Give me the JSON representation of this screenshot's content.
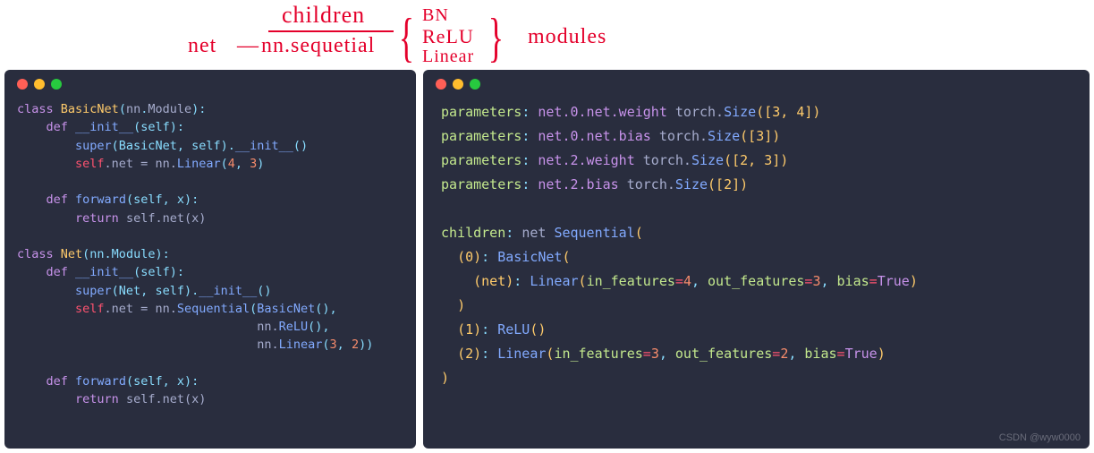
{
  "annotation": {
    "net": "net",
    "dash": "—",
    "children": "children",
    "nnseq": "nn.sequetial",
    "bn": "BN",
    "relu": "ReLU",
    "linear": "Linear",
    "modules": "modules"
  },
  "left": {
    "l1_class": "class",
    "l1_name": "BasicNet",
    "l1_paren_open": "(",
    "l1_nn": "nn",
    "l1_dot": ".",
    "l1_module": "Module",
    "l1_paren_close": "):",
    "l2_def": "def",
    "l2_name": "__init__",
    "l2_args": "(self):",
    "l3_super": "super",
    "l3_args1": "(BasicNet, self).",
    "l3_init": "__init__",
    "l3_end": "()",
    "l4_self": "self",
    "l4_dotnet": ".net = nn.",
    "l4_linear": "Linear",
    "l4_args": "(",
    "l4_n1": "4",
    "l4_comma": ", ",
    "l4_n2": "3",
    "l4_close": ")",
    "l6_def": "def",
    "l6_name": "forward",
    "l6_args": "(self, x):",
    "l7_return": "return",
    "l7_expr": " self.net(x)",
    "l9_class": "class",
    "l9_name": "Net",
    "l9_rest": "(nn.Module):",
    "l10_def": "def",
    "l10_name": "__init__",
    "l10_args": "(self):",
    "l11_super": "super",
    "l11_args": "(Net, self).",
    "l11_init": "__init__",
    "l11_end": "()",
    "l12_self": "self",
    "l12_assign": ".net = nn.",
    "l12_seq": "Sequential",
    "l12_open": "(",
    "l12_basic": "BasicNet",
    "l12_bclose": "(),",
    "l13_nn": "nn.",
    "l13_relu": "ReLU",
    "l13_end": "(),",
    "l14_nn": "nn.",
    "l14_lin": "Linear",
    "l14_open": "(",
    "l14_n1": "3",
    "l14_c": ", ",
    "l14_n2": "2",
    "l14_close": "))",
    "l16_def": "def",
    "l16_name": "forward",
    "l16_args": "(self, x):",
    "l17_return": "return",
    "l17_expr": " self.net(x)"
  },
  "right": {
    "l1_p": "parameters",
    "l1_c": ": ",
    "l1_path": "net.0.net.weight",
    "l1_torch": " torch.",
    "l1_size": "Size",
    "l1_dims": "([3, 4])",
    "l2_p": "parameters",
    "l2_c": ": ",
    "l2_path": "net.0.net.bias",
    "l2_torch": " torch.",
    "l2_size": "Size",
    "l2_dims": "([3])",
    "l3_p": "parameters",
    "l3_c": ": ",
    "l3_path": "net.2.weight",
    "l3_torch": " torch.",
    "l3_size": "Size",
    "l3_dims": "([2, 3])",
    "l4_p": "parameters",
    "l4_c": ": ",
    "l4_path": "net.2.bias",
    "l4_torch": " torch.",
    "l4_size": "Size",
    "l4_dims": "([2])",
    "l6_children": "children",
    "l6_c": ": ",
    "l6_net": "net ",
    "l6_seq": "Sequential",
    "l6_open": "(",
    "l7_idx": "(0)",
    "l7_c": ": ",
    "l7_basic": "BasicNet",
    "l7_open": "(",
    "l8_net": "(net)",
    "l8_c": ": ",
    "l8_lin": "Linear",
    "l8_open": "(",
    "l8_if": "in_features",
    "l8_eq1": "=",
    "l8_v1": "4",
    "l8_cm1": ", ",
    "l8_of": "out_features",
    "l8_eq2": "=",
    "l8_v2": "3",
    "l8_cm2": ", ",
    "l8_bias": "bias",
    "l8_eq3": "=",
    "l8_true": "True",
    "l8_close": ")",
    "l9_close": ")",
    "l10_idx": "(1)",
    "l10_c": ": ",
    "l10_relu": "ReLU",
    "l10_end": "()",
    "l11_idx": "(2)",
    "l11_c": ": ",
    "l11_lin": "Linear",
    "l11_open": "(",
    "l11_if": "in_features",
    "l11_eq1": "=",
    "l11_v1": "3",
    "l11_cm1": ", ",
    "l11_of": "out_features",
    "l11_eq2": "=",
    "l11_v2": "2",
    "l11_cm2": ", ",
    "l11_bias": "bias",
    "l11_eq3": "=",
    "l11_true": "True",
    "l11_close": ")",
    "l12_close": ")"
  },
  "watermark": "CSDN @wyw0000"
}
